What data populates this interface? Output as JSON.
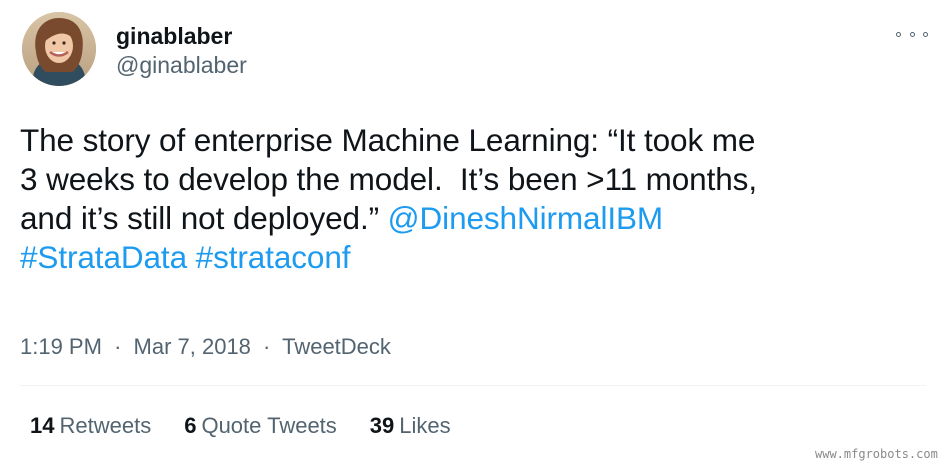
{
  "author": {
    "display_name": "ginablaber",
    "handle": "@ginablaber",
    "avatar_icon": "profile-photo"
  },
  "tweet": {
    "text_lines": [
      "The story of enterprise Machine Learning: “It took me",
      "3 weeks to develop the model.  It’s been >11 months,",
      "and it’s still not deployed.” "
    ],
    "mention": "@DineshNirmalIBM",
    "hashtags": [
      "#StrataData",
      "#strataconf"
    ]
  },
  "meta": {
    "time": "1:19 PM",
    "date": "Mar 7, 2018",
    "separator": "·",
    "source": "TweetDeck"
  },
  "stats": {
    "retweets": {
      "count": "14",
      "label": "Retweets"
    },
    "quote_tweets": {
      "count": "6",
      "label": "Quote Tweets"
    },
    "likes": {
      "count": "39",
      "label": "Likes"
    }
  },
  "more_icon": "more-options-icon",
  "watermark": "www.mfgrobots.com",
  "colors": {
    "link": "#1d9bf0",
    "text": "#0f1419",
    "secondary": "#536471",
    "divider": "#eff3f4"
  }
}
